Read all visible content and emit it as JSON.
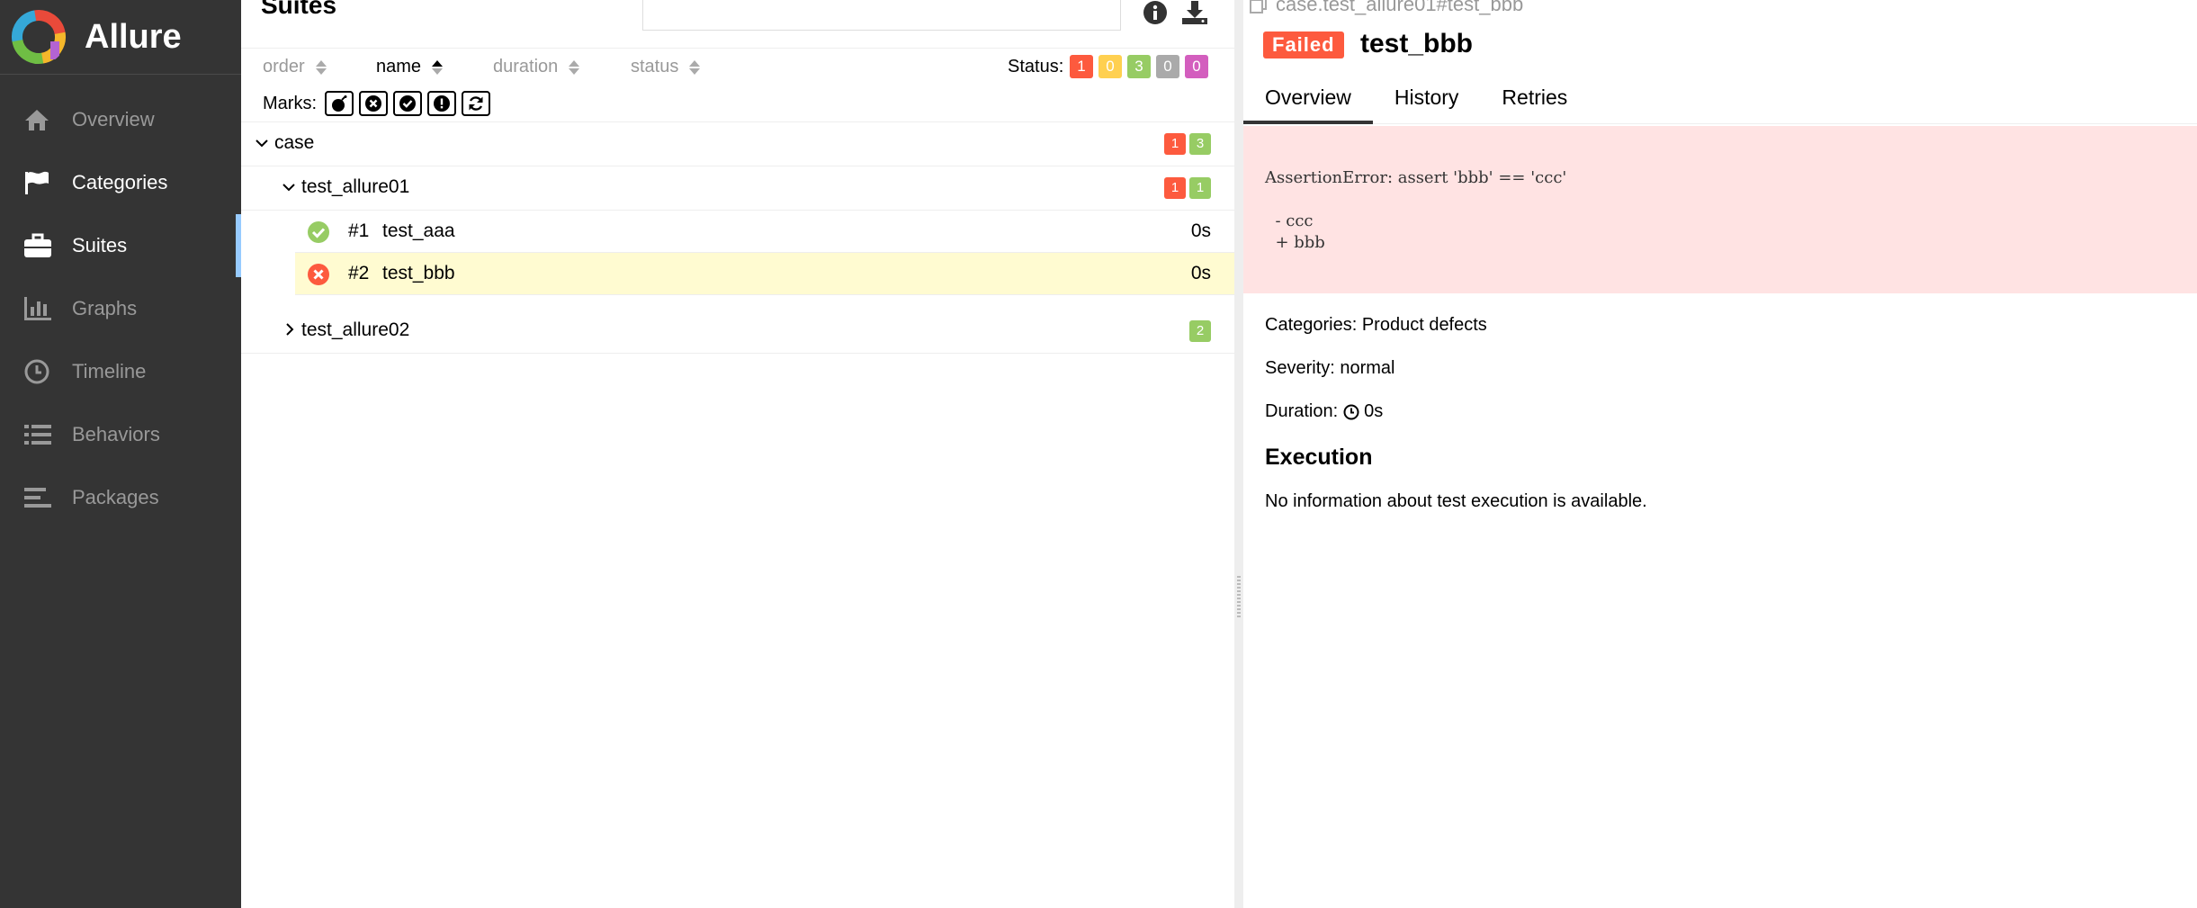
{
  "app": {
    "brand": "Allure",
    "nav": [
      {
        "label": "Overview",
        "icon": "home-icon"
      },
      {
        "label": "Categories",
        "icon": "flag-icon"
      },
      {
        "label": "Suites",
        "icon": "briefcase-icon"
      },
      {
        "label": "Graphs",
        "icon": "bar-chart-icon"
      },
      {
        "label": "Timeline",
        "icon": "clock-icon"
      },
      {
        "label": "Behaviors",
        "icon": "list-icon"
      },
      {
        "label": "Packages",
        "icon": "align-left-icon"
      }
    ]
  },
  "tree": {
    "title": "Suites",
    "sort": {
      "order": "order",
      "name": "name",
      "duration": "duration",
      "status": "status"
    },
    "status_label": "Status:",
    "status_counts": [
      {
        "value": "1",
        "color": "#fd5a3e"
      },
      {
        "value": "0",
        "color": "#ffd050"
      },
      {
        "value": "3",
        "color": "#97cc64"
      },
      {
        "value": "0",
        "color": "#aaaaaa"
      },
      {
        "value": "0",
        "color": "#d35ebe"
      }
    ],
    "marks_label": "Marks:",
    "rows": {
      "case": {
        "label": "case",
        "failed": "1",
        "passed": "3"
      },
      "allure01": {
        "label": "test_allure01",
        "failed": "1",
        "passed": "1"
      },
      "test1": {
        "num": "#1",
        "label": "test_aaa",
        "duration": "0s"
      },
      "test2": {
        "num": "#2",
        "label": "test_bbb",
        "duration": "0s"
      },
      "allure02": {
        "label": "test_allure02",
        "passed": "2"
      }
    }
  },
  "detail": {
    "path": "case.test_allure01#test_bbb",
    "status": "Failed",
    "title": "test_bbb",
    "tabs": [
      "Overview",
      "History",
      "Retries"
    ],
    "error": "AssertionError: assert 'bbb' == 'ccc'\n\n  - ccc\n  + bbb",
    "categories": "Categories: Product defects",
    "severity": "Severity: normal",
    "duration_label": "Duration:",
    "duration_value": "0s",
    "execution_title": "Execution",
    "execution_text": "No information about test execution is available."
  }
}
